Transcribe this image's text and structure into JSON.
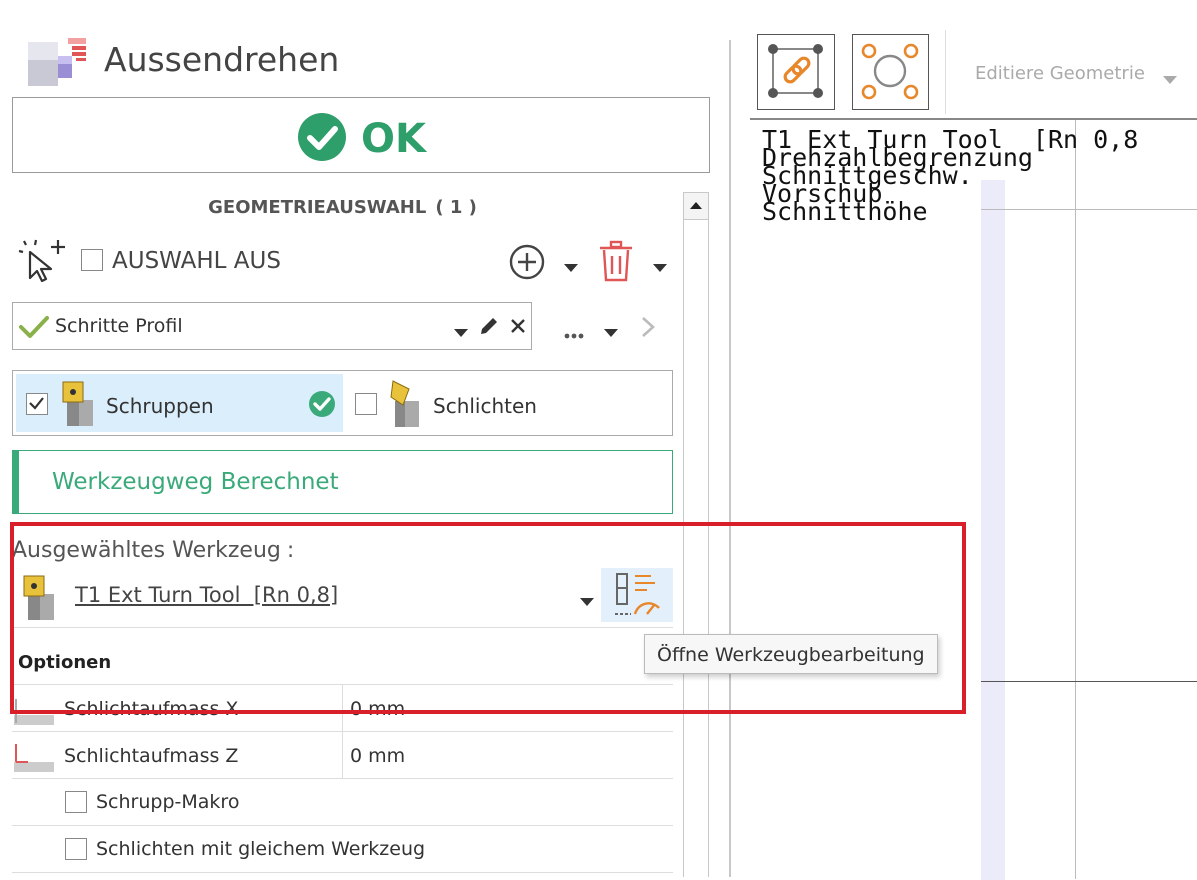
{
  "header": {
    "title": "Aussendrehen"
  },
  "status": {
    "ok_label": "OK"
  },
  "geometry": {
    "section_title": "GEOMETRIEAUSWAHL ( 1 )",
    "selection_off_label": "AUSWAHL AUS"
  },
  "profile": {
    "selected": "Schritte Profil"
  },
  "steps": [
    {
      "label": "Schruppen",
      "checked": true
    },
    {
      "label": "Schlichten",
      "checked": false
    }
  ],
  "toolpath_status": "Werkzeugweg Berechnet",
  "tool": {
    "heading": "Ausgewähltes Werkzeug",
    "colon": ":",
    "name": "T1 Ext Turn Tool  [Rn 0,8]",
    "tooltip": "Öffne Werkzeugbearbeitung"
  },
  "options": {
    "title": "Optionen",
    "rows": [
      {
        "label": "Schlichtaufmass X",
        "value": "0 mm"
      },
      {
        "label": "Schlichtaufmass Z",
        "value": "0 mm"
      }
    ],
    "checkboxes": [
      {
        "label": "Schrupp-Makro"
      },
      {
        "label": "Schlichten mit gleichem Werkzeug"
      }
    ]
  },
  "toolbar": {
    "edit_geometry_label": "Editiere Geometrie"
  },
  "viewport": {
    "lines": [
      "T1 Ext Turn Tool  [Rn 0,8",
      "Drehzahlbegrenzung",
      "Schnittgeschw.",
      "Vorschub",
      "Schnitthöhe"
    ]
  },
  "colors": {
    "accent_green": "#3aaa7a",
    "ok_green": "#2e9e6a",
    "highlight_red": "#d9202a",
    "icon_orange": "#e8862a",
    "delete_red": "#e05555"
  }
}
